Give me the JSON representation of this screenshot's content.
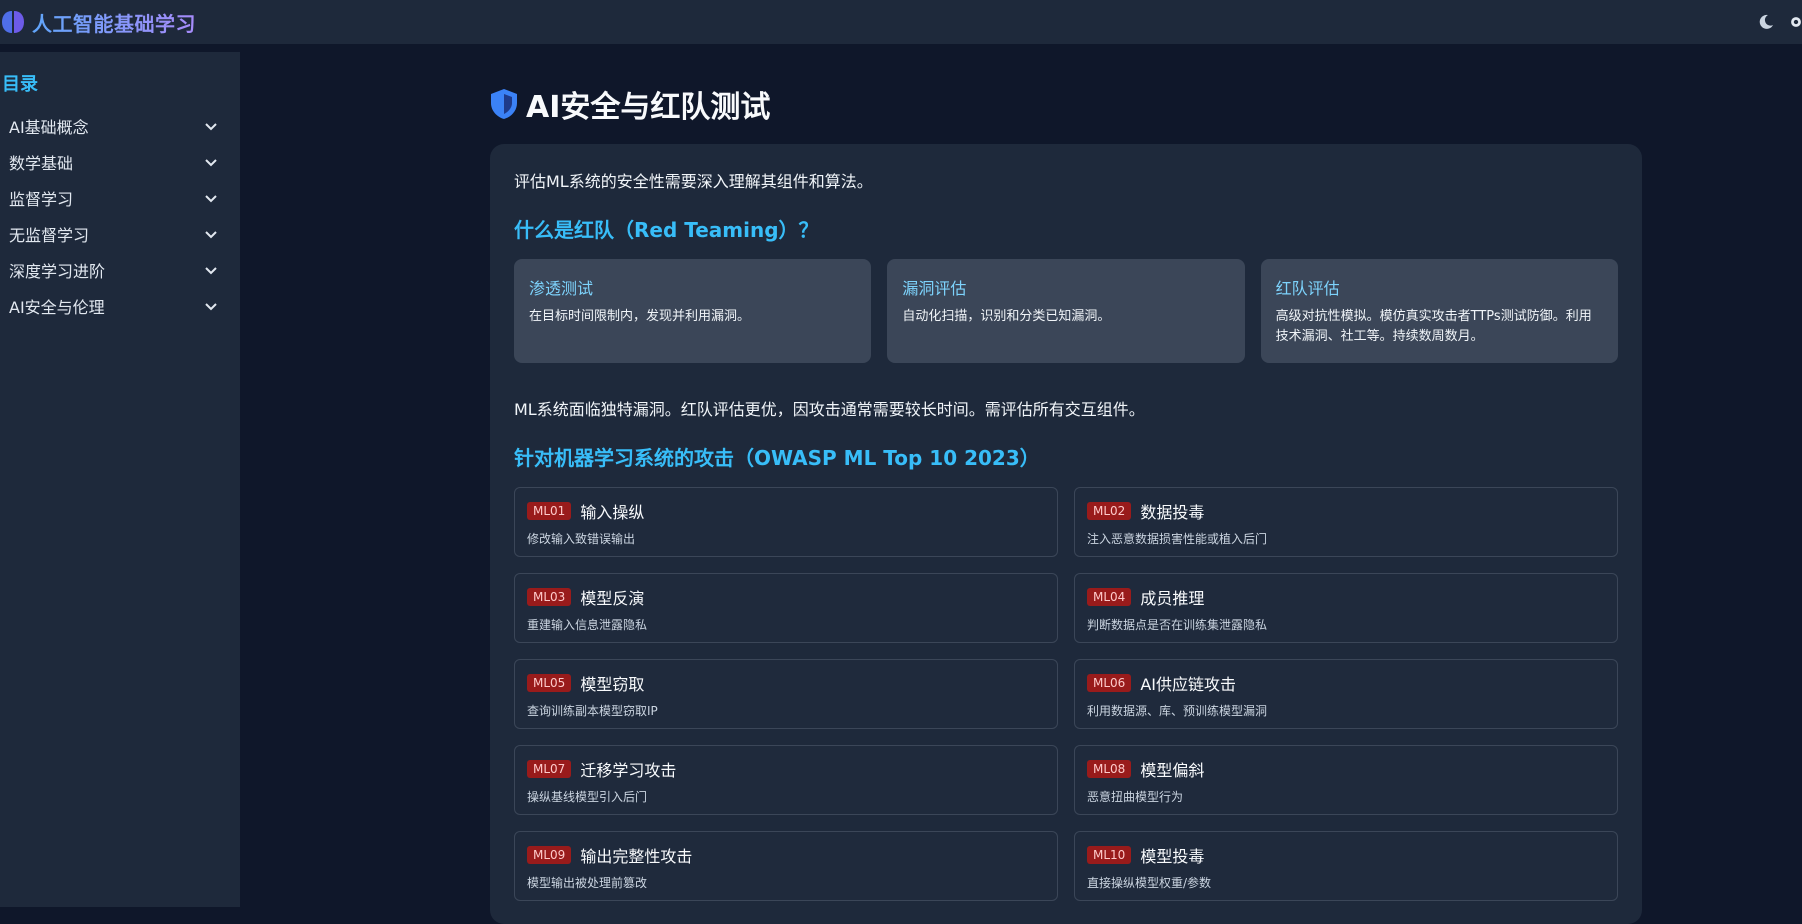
{
  "app": {
    "title": "人工智能基础学习",
    "accent": "#818cf8",
    "theme_icon": "moon-icon"
  },
  "sidebar": {
    "title": "目录",
    "items": [
      {
        "label": "AI基础概念"
      },
      {
        "label": "数学基础"
      },
      {
        "label": "监督学习"
      },
      {
        "label": "无监督学习"
      },
      {
        "label": "深度学习进阶"
      },
      {
        "label": "AI安全与伦理"
      }
    ]
  },
  "main": {
    "title": "AI安全与红队测试",
    "intro": "评估ML系统的安全性需要深入理解其组件和算法。",
    "section1": "什么是红队（Red Teaming）？",
    "types": [
      {
        "title": "渗透测试",
        "desc": "在目标时间限制内，发现并利用漏洞。"
      },
      {
        "title": "漏洞评估",
        "desc": "自动化扫描，识别和分类已知漏洞。"
      },
      {
        "title": "红队评估",
        "desc": "高级对抗性模拟。模仿真实攻击者TTPs测试防御。利用技术漏洞、社工等。持续数周数月。"
      }
    ],
    "summary": "ML系统面临独特漏洞。红队评估更优，因攻击通常需要较长时间。需评估所有交互组件。",
    "section2": "针对机器学习系统的攻击（OWASP ML Top 10 2023）",
    "attacks": [
      {
        "code": "ML01",
        "name": "输入操纵",
        "desc": "修改输入致错误输出"
      },
      {
        "code": "ML02",
        "name": "数据投毒",
        "desc": "注入恶意数据损害性能或植入后门"
      },
      {
        "code": "ML03",
        "name": "模型反演",
        "desc": "重建输入信息泄露隐私"
      },
      {
        "code": "ML04",
        "name": "成员推理",
        "desc": "判断数据点是否在训练集泄露隐私"
      },
      {
        "code": "ML05",
        "name": "模型窃取",
        "desc": "查询训练副本模型窃取IP"
      },
      {
        "code": "ML06",
        "name": "AI供应链攻击",
        "desc": "利用数据源、库、预训练模型漏洞"
      },
      {
        "code": "ML07",
        "name": "迁移学习攻击",
        "desc": "操纵基线模型引入后门"
      },
      {
        "code": "ML08",
        "name": "模型偏斜",
        "desc": "恶意扭曲模型行为"
      },
      {
        "code": "ML09",
        "name": "输出完整性攻击",
        "desc": "模型输出被处理前篡改"
      },
      {
        "code": "ML10",
        "name": "模型投毒",
        "desc": "直接操纵模型权重/参数"
      }
    ]
  }
}
